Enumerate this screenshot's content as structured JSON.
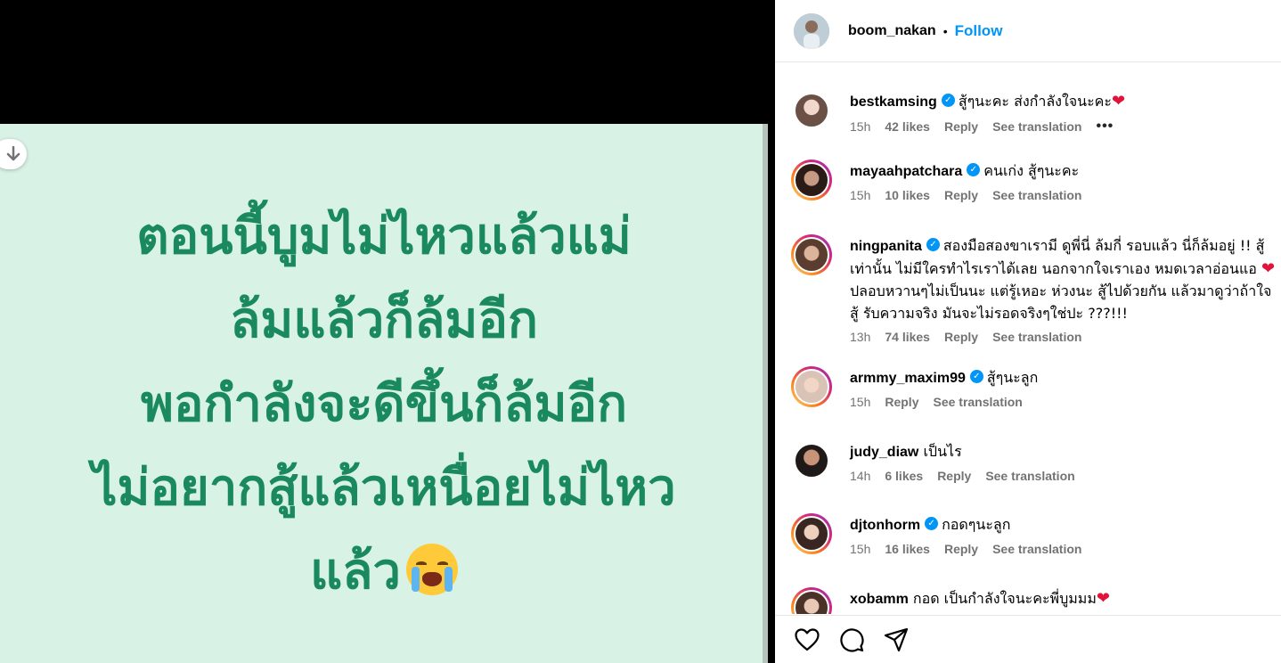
{
  "post": {
    "image_lines": [
      "ตอนนี้บูมไม่ไหวแล้วแม่",
      "ล้มแล้วก็ล้มอีก",
      "พอกำลังจะดีขึ้นก็ล้มอีก",
      "ไม่อยากสู้แล้วเหนื่อยไม่ไหว",
      "แล้ว"
    ],
    "image_bg_color": "#d9f2e6",
    "image_text_color": "#1a8a5e"
  },
  "header": {
    "username": "boom_nakan",
    "separator": "•",
    "follow_label": "Follow"
  },
  "comments": [
    {
      "username": "bestkamsing",
      "verified": true,
      "text": "สู้ๆนะคะ ส่งกำลังใจนะคะ",
      "heart": "❤",
      "time": "15h",
      "likes": "42 likes",
      "reply": "Reply",
      "translation": "See translation",
      "more": "•••",
      "ring": false
    },
    {
      "username": "mayaahpatchara",
      "verified": true,
      "text": "คนเก่ง สู้ๆนะคะ",
      "heart": "",
      "time": "15h",
      "likes": "10 likes",
      "reply": "Reply",
      "translation": "See translation",
      "more": "",
      "ring": true
    },
    {
      "username": "ningpanita",
      "verified": true,
      "text": "สองมือสองขาเรามี ดูพี่นี่ ล้มกี่ รอบแล้ว นี่ก็ล้มอยู่ !! สู้เท่านั้น ไม่มีใครทำไรเราได้เลย นอกจากใจเราเอง หมดเวลาอ่อนแอ",
      "heart": "❤",
      "text2": " ปลอบหวานๆไม่เป็นนะ แต่รู้เหอะ ห่วงนะ สู้ไปด้วยกัน แล้วมาดูว่าถ้าใจสู้ รับความจริง มันจะไม่รอดจริงๆใช่ปะ ???!!!",
      "time": "13h",
      "likes": "74 likes",
      "reply": "Reply",
      "translation": "See translation",
      "more": "",
      "ring": true
    },
    {
      "username": "armmy_maxim99",
      "verified": true,
      "text": "สู้ๆนะลูก",
      "heart": "",
      "time": "15h",
      "likes": "",
      "reply": "Reply",
      "translation": "See translation",
      "more": "",
      "ring": true
    },
    {
      "username": "judy_diaw",
      "verified": false,
      "text": "เป็นไร",
      "heart": "",
      "time": "14h",
      "likes": "6 likes",
      "reply": "Reply",
      "translation": "See translation",
      "more": "",
      "ring": false
    },
    {
      "username": "djtonhorm",
      "verified": true,
      "text": "กอดๆนะลูก",
      "heart": "",
      "time": "15h",
      "likes": "16 likes",
      "reply": "Reply",
      "translation": "See translation",
      "more": "",
      "ring": true
    },
    {
      "username": "xobamm",
      "verified": false,
      "text": "กอด เป็นกำลังใจนะคะพี่บูมมม",
      "heart": "❤",
      "time": "",
      "likes": "",
      "reply": "",
      "translation": "",
      "more": "",
      "ring": true
    }
  ],
  "icons": {
    "scroll": "arrow-down-icon",
    "like": "heart-icon",
    "comment": "comment-icon",
    "share": "share-icon",
    "verified": "verified-badge-icon"
  },
  "colors": {
    "accent": "#0095f6",
    "heart": "#e0133b"
  }
}
